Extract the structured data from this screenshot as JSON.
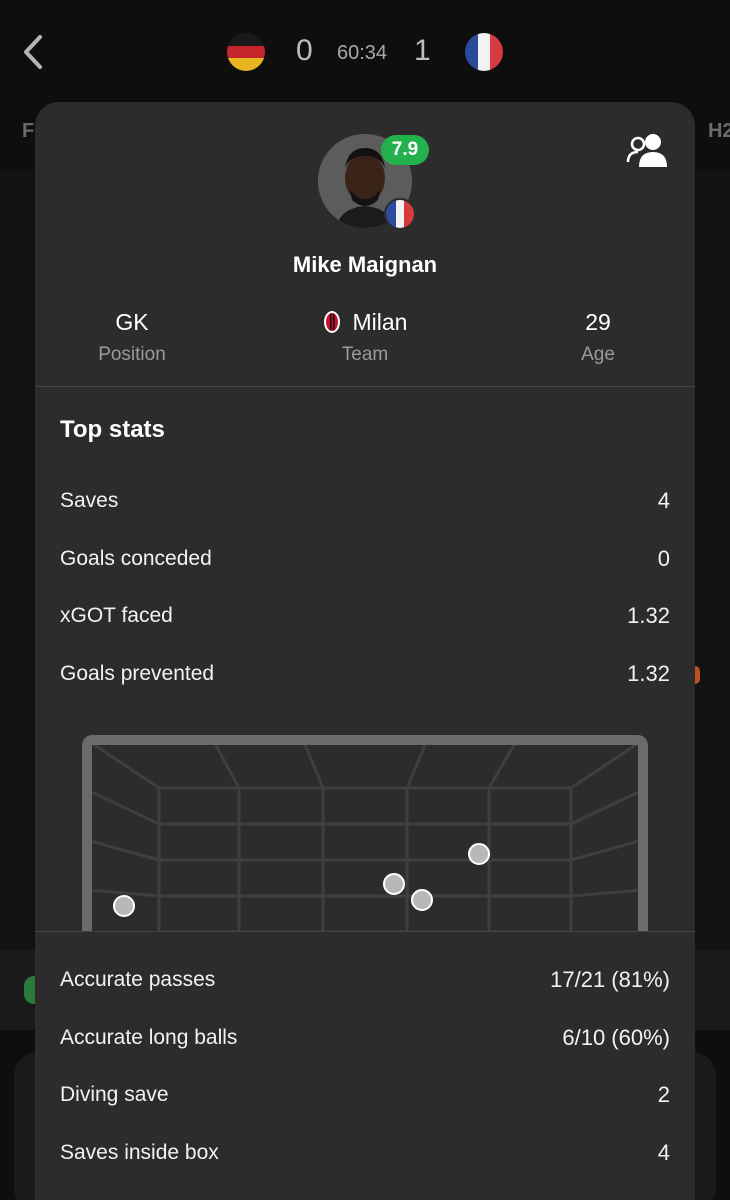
{
  "match": {
    "home_score": "0",
    "away_score": "1",
    "time": "60:34",
    "tab_left_partial": "F",
    "tab_right_partial": "H2"
  },
  "player": {
    "name": "Mike Maignan",
    "rating": "7.9",
    "info": [
      {
        "value": "GK",
        "label": "Position"
      },
      {
        "value": "Milan",
        "label": "Team"
      },
      {
        "value": "29",
        "label": "Age"
      }
    ]
  },
  "top_stats": {
    "title": "Top stats",
    "rows": [
      {
        "label": "Saves",
        "value": "4"
      },
      {
        "label": "Goals conceded",
        "value": "0"
      },
      {
        "label": "xGOT faced",
        "value": "1.32"
      },
      {
        "label": "Goals prevented",
        "value": "1.32"
      }
    ]
  },
  "more_stats": {
    "rows": [
      {
        "label": "Accurate passes",
        "value": "17/21 (81%)"
      },
      {
        "label": "Accurate long balls",
        "value": "6/10 (60%)"
      },
      {
        "label": "Diving save",
        "value": "2"
      },
      {
        "label": "Saves inside box",
        "value": "4"
      }
    ]
  },
  "colors": {
    "rating_green": "#22b14c",
    "modal_bg": "#2c2c2c",
    "page_bg": "#0e0e0e"
  },
  "icons": {
    "back": "chevron-left-icon",
    "profile": "user-profile-icon",
    "team": "ac-milan-crest-icon"
  }
}
